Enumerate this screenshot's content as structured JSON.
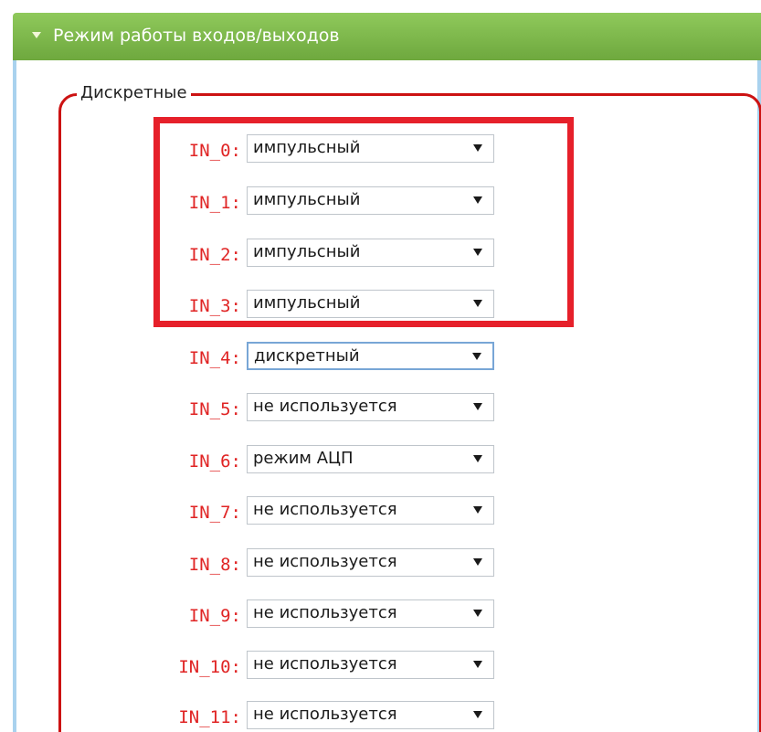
{
  "section": {
    "title": "Режим работы входов/выходов",
    "fieldset_legend": "Дискретные"
  },
  "inputs": [
    {
      "label": "IN_0:",
      "value": "импульсный"
    },
    {
      "label": "IN_1:",
      "value": "импульсный"
    },
    {
      "label": "IN_2:",
      "value": "импульсный"
    },
    {
      "label": "IN_3:",
      "value": "импульсный"
    },
    {
      "label": "IN_4:",
      "value": "дискретный"
    },
    {
      "label": "IN_5:",
      "value": "не используется"
    },
    {
      "label": "IN_6:",
      "value": "режим АЦП"
    },
    {
      "label": "IN_7:",
      "value": "не используется"
    },
    {
      "label": "IN_8:",
      "value": "не используется"
    },
    {
      "label": "IN_9:",
      "value": "не используется"
    },
    {
      "label": "IN_10:",
      "value": "не используется"
    },
    {
      "label": "IN_11:",
      "value": "не используется"
    }
  ],
  "colors": {
    "header_green": "#7ab648",
    "label_red": "#e02424",
    "fieldset_border": "#cc1212",
    "highlight_box": "#e6202a",
    "panel_border_blue": "#a9d2ee"
  },
  "icons": {
    "header_toggle": "triangle-down-icon",
    "select_arrow": "dropdown-arrow-icon"
  }
}
